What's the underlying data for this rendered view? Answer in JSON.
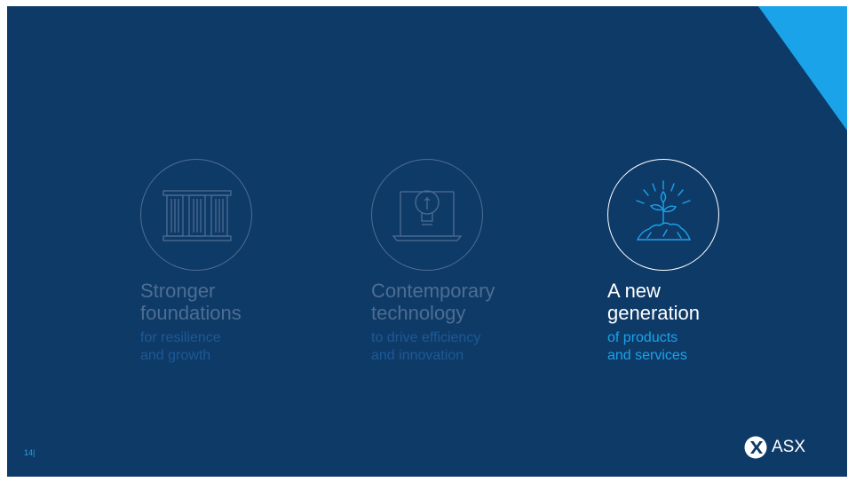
{
  "slide": {
    "page_number": "14|",
    "accent_color": "#0e3a68",
    "corner_color": "#1aa3e8"
  },
  "pillars": [
    {
      "title": "Stronger\nfoundations",
      "subtitle": "for resilience\nand growth",
      "icon": "columns-icon",
      "active": false
    },
    {
      "title": "Contemporary\ntechnology",
      "subtitle": "to drive efficiency\nand innovation",
      "icon": "lightbulb-laptop-icon",
      "active": false
    },
    {
      "title": "A new\ngeneration",
      "subtitle": "of products\nand services",
      "icon": "sprout-icon",
      "active": true
    }
  ],
  "logo": {
    "text": "ASX",
    "icon": "asx-x-logo-icon"
  }
}
